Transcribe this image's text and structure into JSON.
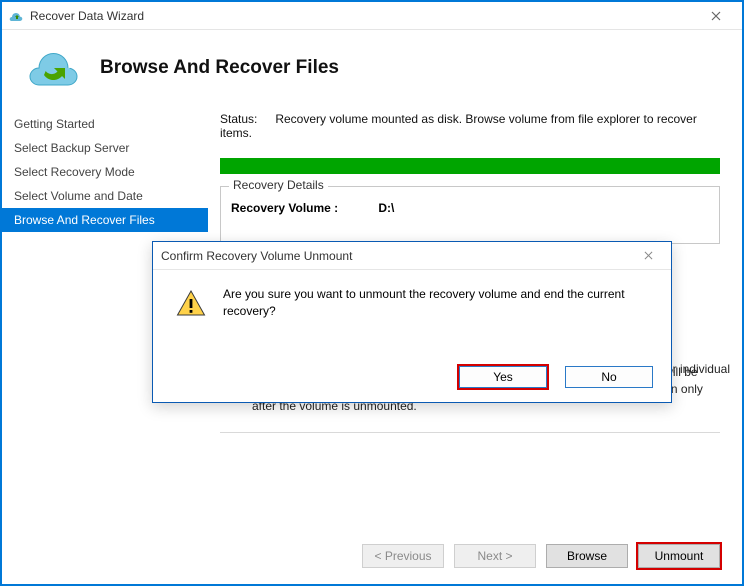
{
  "window": {
    "title": "Recover Data Wizard"
  },
  "header": {
    "title": "Browse And Recover Files"
  },
  "sidebar": {
    "items": [
      {
        "label": "Getting Started"
      },
      {
        "label": "Select Backup Server"
      },
      {
        "label": "Select Recovery Mode"
      },
      {
        "label": "Select Volume and Date"
      },
      {
        "label": "Browse And Recover Files"
      }
    ],
    "active_index": 4
  },
  "status": {
    "label": "Status:",
    "text": "Recovery volume mounted as disk. Browse volume from file explorer to recover items."
  },
  "recovery_details": {
    "group_title": "Recovery Details",
    "volume_label": "Recovery Volume  :",
    "volume_value": "D:\\"
  },
  "hint_partial": "cover individual",
  "warning_note": "Recovery volume will remain mounted till 1/31/2017 8:44:48 AM after which it will be automatically unmounted. Any backups scheduled to run during this time will run only after the volume is unmounted.",
  "buttons": {
    "previous": "< Previous",
    "next": "Next >",
    "browse": "Browse",
    "unmount": "Unmount"
  },
  "dialog": {
    "title": "Confirm Recovery Volume Unmount",
    "message": "Are you sure you want to unmount the recovery volume and end the current recovery?",
    "yes": "Yes",
    "no": "No"
  }
}
